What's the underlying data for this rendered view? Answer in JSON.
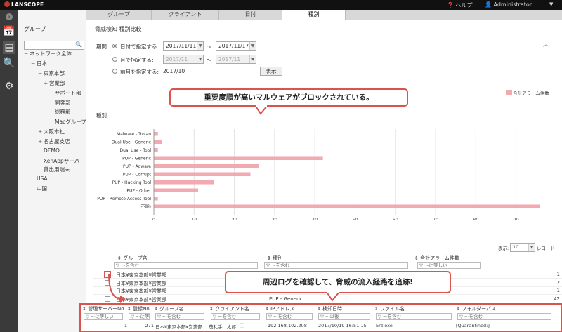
{
  "topbar": {
    "logo": "LANSCOPE",
    "help": "ヘルプ",
    "user": "Administrator"
  },
  "rail": {
    "icons": [
      "calendar-icon",
      "document-icon",
      "search-icon",
      "gear-icon"
    ]
  },
  "tree": {
    "title": "グループ",
    "items": [
      {
        "label": "ネットワーク全体",
        "exp": "−"
      },
      {
        "label": "日本",
        "exp": "−"
      },
      {
        "label": "東京本部",
        "exp": "−"
      },
      {
        "label": "営業部",
        "exp": "+"
      },
      {
        "label": "サポート部",
        "exp": ""
      },
      {
        "label": "開発部",
        "exp": ""
      },
      {
        "label": "総務部",
        "exp": ""
      },
      {
        "label": "Macグループ",
        "exp": ""
      },
      {
        "label": "大阪本社",
        "exp": "+"
      },
      {
        "label": "名古屋支店",
        "exp": "+"
      },
      {
        "label": "DEMO",
        "exp": ""
      },
      {
        "label": "XenAppサーバ",
        "exp": ""
      },
      {
        "label": "貸出用端末",
        "exp": ""
      },
      {
        "label": "USA",
        "exp": ""
      },
      {
        "label": "中国",
        "exp": ""
      }
    ]
  },
  "tabs": [
    "グループ",
    "クライアント",
    "日付",
    "種別"
  ],
  "main": {
    "title": "脅威検知 種別比較",
    "period_label": "期間:",
    "opt_date": "日付で指定する:",
    "opt_month": "月で指定する:",
    "opt_prev": "前月を指定する:",
    "date_from": "2017/11/11",
    "date_to": "2017/11/17",
    "month_from": "2017/11",
    "month_to": "2017/11",
    "prev_month": "2017/10",
    "tilde": "〜",
    "show_button": "表示"
  },
  "callouts": {
    "top": "重要度順が高いマルウェアがブロックされている。",
    "bottom": "周辺ログを確認して、脅威の流入経路を追跡!"
  },
  "chart_data": {
    "type": "bar",
    "orientation": "horizontal",
    "ylabel": "種別",
    "legend": "合計アラーム件数",
    "legend_position": "top-right",
    "categories": [
      "Malware - Trojan",
      "Dual Use - Generic",
      "Dual Use - Tool",
      "PUP - Generic",
      "PUP - Adware",
      "PUP - Corrupt",
      "PUP - Hacking Tool",
      "PUP - Other",
      "PUP - Remote Access Tool",
      "(不明)"
    ],
    "values": [
      1,
      2,
      1,
      42,
      26,
      24,
      15,
      11,
      1,
      96
    ],
    "xlim": [
      0,
      96
    ],
    "xticks": [
      0,
      10,
      20,
      30,
      40,
      50,
      60,
      70,
      80,
      90
    ],
    "grid": true,
    "color": "#f2a9b0"
  },
  "grid1": {
    "display_label": "表示:",
    "display_count": "10",
    "records_label": "レコード",
    "headers": [
      "グループ名",
      "種別",
      "合計アラーム件数"
    ],
    "filters": [
      "〜を含む",
      "〜を含む",
      "〜に等しい"
    ],
    "rows": [
      {
        "group": "日本¥東京本部¥営業部",
        "type": "",
        "count": "1"
      },
      {
        "group": "日本¥東京本部¥営業部",
        "type": "",
        "count": "2"
      },
      {
        "group": "日本¥東京本部¥営業部",
        "type": "",
        "count": "1"
      },
      {
        "group": "日本¥東京本部¥営業部",
        "type": "PUP - Generic",
        "count": "42"
      }
    ]
  },
  "grid2": {
    "headers": [
      "管理サーバーNo",
      "登録No",
      "グループ名",
      "クライアント名",
      "IPアドレス",
      "検知日時",
      "ファイル名",
      "フォルダーパス"
    ],
    "filters": [
      "〜に等しい",
      "〜に等",
      "〜を含む",
      "〜を含む",
      "〜を含む",
      "〜以後",
      "〜を含む",
      "〜を含む"
    ],
    "row": {
      "server_no": "1",
      "reg_no": "271",
      "group": "日本¥東京本部¥営業部",
      "client": "茂礼手　太郎",
      "ip": "192.168.102.208",
      "datetime": "2017/10/19 16:51:15",
      "file": "Erz.exe",
      "path": "[Quarantined:]"
    }
  }
}
